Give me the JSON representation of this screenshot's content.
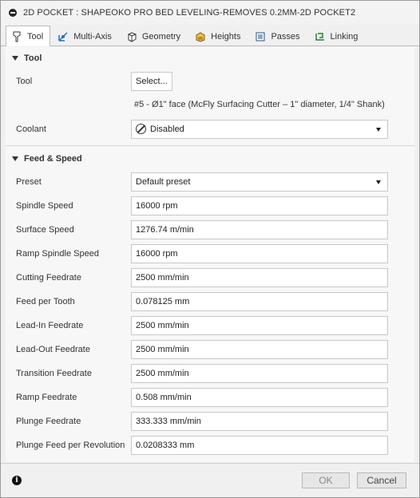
{
  "window": {
    "title": "2D POCKET : SHAPEOKO PRO BED LEVELING-REMOVES 0.2MM-2D POCKET2"
  },
  "tabs": [
    {
      "label": "Tool",
      "icon": "tool-icon",
      "active": true
    },
    {
      "label": "Multi-Axis",
      "icon": "multi-axis-icon"
    },
    {
      "label": "Geometry",
      "icon": "geometry-icon"
    },
    {
      "label": "Heights",
      "icon": "heights-icon"
    },
    {
      "label": "Passes",
      "icon": "passes-icon"
    },
    {
      "label": "Linking",
      "icon": "linking-icon"
    }
  ],
  "tool_section": {
    "header": "Tool",
    "tool_label": "Tool",
    "select_button": "Select...",
    "tool_description": "#5 - Ø1\" face (McFly Surfacing Cutter – 1\" diameter, 1/4\" Shank)",
    "coolant_label": "Coolant",
    "coolant_value": "Disabled"
  },
  "feed_section": {
    "header": "Feed & Speed",
    "preset_label": "Preset",
    "preset_value": "Default preset",
    "rows": [
      {
        "label": "Spindle Speed",
        "value": "16000 rpm"
      },
      {
        "label": "Surface Speed",
        "value": "1276.74 m/min"
      },
      {
        "label": "Ramp Spindle Speed",
        "value": "16000 rpm"
      },
      {
        "label": "Cutting Feedrate",
        "value": "2500 mm/min"
      },
      {
        "label": "Feed per Tooth",
        "value": "0.078125 mm"
      },
      {
        "label": "Lead-In Feedrate",
        "value": "2500 mm/min"
      },
      {
        "label": "Lead-Out Feedrate",
        "value": "2500 mm/min"
      },
      {
        "label": "Transition Feedrate",
        "value": "2500 mm/min"
      },
      {
        "label": "Ramp Feedrate",
        "value": "0.508 mm/min"
      },
      {
        "label": "Plunge Feedrate",
        "value": "333.333 mm/min"
      },
      {
        "label": "Plunge Feed per Revolution",
        "value": "0.0208333 mm"
      }
    ]
  },
  "footer": {
    "ok": "OK",
    "cancel": "Cancel",
    "info_icon": "info-icon"
  }
}
